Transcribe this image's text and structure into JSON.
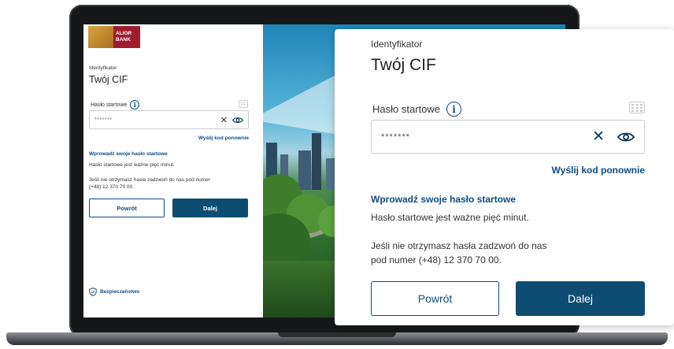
{
  "brand": {
    "logo_line1": "ALIOR",
    "logo_line2": "BANK",
    "accent": "#0f4c81",
    "button_primary": "#0f4c72",
    "logo_red": "#a01c2c"
  },
  "form": {
    "id_label": "Identyfikator",
    "id_value": "Twój CIF",
    "password_label": "Hasło startowe",
    "password_value": "*******",
    "info_icon": "info-icon",
    "keypad_icon": "keypad-icon",
    "clear_icon": "close-icon",
    "show_icon": "eye-icon",
    "resend_link": "Wyślij kod ponownie",
    "instruction_heading": "Wprowadź swoje hasło startowe",
    "validity_text": "Hasło startowe jest ważne pięć minut.",
    "help_text": "Jeśli nie otrzymasz hasła zadzwoń do nas pod numer (+48) 12 370 70 00.",
    "back_button": "Powrót",
    "next_button": "Dalej",
    "security_link": "Bezpieczeństwo",
    "security_icon": "shield-icon"
  }
}
